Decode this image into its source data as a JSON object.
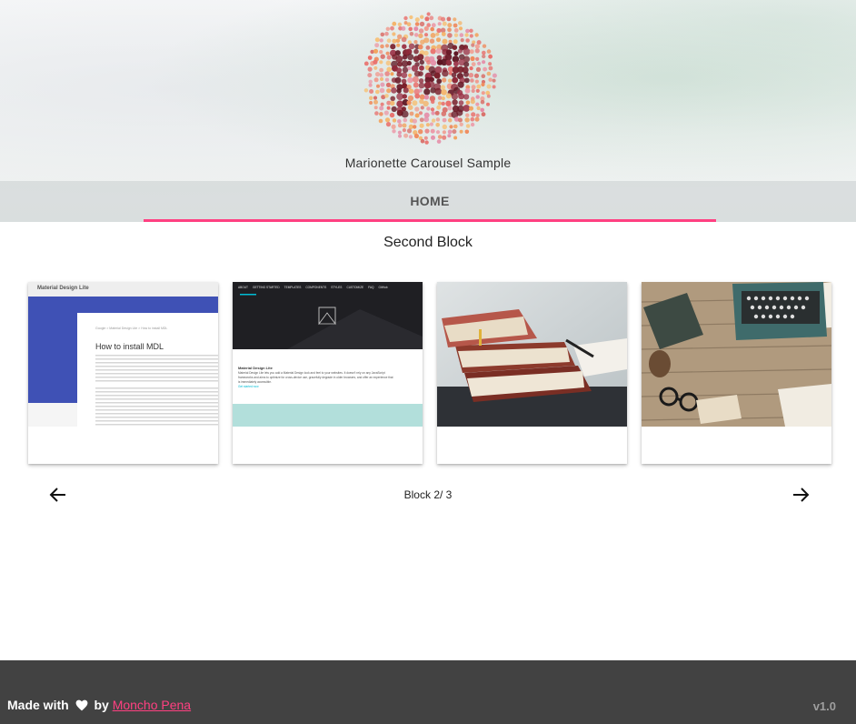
{
  "header": {
    "title": "Marionette Carousel Sample",
    "logo_letter": "M",
    "nav": {
      "tabs": [
        {
          "label": "HOME",
          "active": true
        }
      ],
      "accent": "#ff4081"
    }
  },
  "main": {
    "block_title": "Second Block",
    "cards": [
      {
        "kind": "mdl-install-page",
        "bar_title": "Material Design Lite",
        "breadcrumb": "Google > Material Design Lite > How to install MDL",
        "heading": "How to install MDL"
      },
      {
        "kind": "mdl-homepage",
        "menu": [
          "ABOUT",
          "GETTING STARTED",
          "TEMPLATES",
          "COMPONENTS",
          "STYLES",
          "CUSTOMIZE",
          "FAQ",
          "GitHub"
        ],
        "section_title": "Material Design Lite",
        "body_lines": [
          "Material Design Lite lets you add a Material Design look and feel to your websites. It doesn't rely on any JavaScript",
          "frameworks and aims to optimize for cross-device use, gracefully degrade in older browsers, and offer an experience that",
          "is immediately accessible."
        ],
        "link_text": "Get started now"
      },
      {
        "kind": "photo",
        "icon": "books-photo"
      },
      {
        "kind": "photo",
        "icon": "typewriter-desk-photo"
      }
    ],
    "pager": {
      "text": "Block 2/ 3",
      "prev_icon": "arrow-left-icon",
      "next_icon": "arrow-right-icon"
    }
  },
  "footer": {
    "made_with": "Made with",
    "heart_icon": "heart-icon",
    "by": "by",
    "author": "Moncho Pena",
    "version": "v1.0"
  },
  "colors": {
    "accent": "#ff4081",
    "footer_bg": "#424242",
    "mdl_indigo": "#3f51b5"
  }
}
